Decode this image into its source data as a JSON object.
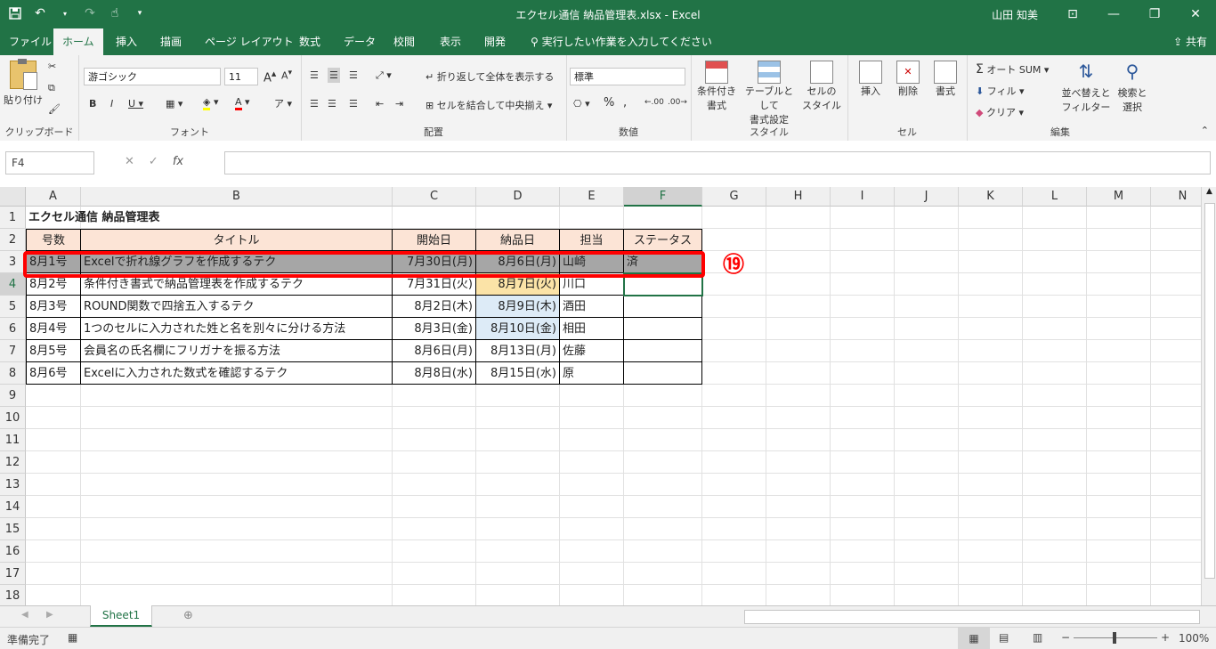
{
  "window": {
    "title": "エクセル通信 納品管理表.xlsx  -  Excel",
    "user": "山田 知美",
    "accent": "#217346"
  },
  "ribbon_tabs": [
    "ファイル",
    "ホーム",
    "挿入",
    "描画",
    "ページ レイアウト",
    "数式",
    "データ",
    "校閲",
    "表示",
    "開発"
  ],
  "tell_me": "実行したい作業を入力してください",
  "share_label": "共有",
  "ribbon": {
    "clipboard_group": "クリップボード",
    "paste_label": "貼り付け",
    "font_group": "フォント",
    "font_name": "游ゴシック",
    "font_size": "11",
    "alignment_group": "配置",
    "wrap_text": "折り返して全体を表示する",
    "merge_center": "セルを結合して中央揃え",
    "number_group": "数値",
    "number_format": "標準",
    "styles_group": "スタイル",
    "conditional_format": "条件付き",
    "conditional_format2": "書式",
    "format_as_table": "テーブルとして",
    "format_as_table2": "書式設定",
    "cell_styles": "セルの",
    "cell_styles2": "スタイル",
    "cells_group": "セル",
    "insert": "挿入",
    "delete": "削除",
    "format": "書式",
    "editing_group": "編集",
    "autosum": "オート SUM",
    "fill": "フィル",
    "clear": "クリア",
    "sort_filter": "並べ替えと",
    "sort_filter2": "フィルター",
    "find_select": "検索と",
    "find_select2": "選択"
  },
  "formula_bar": {
    "name_box": "F4",
    "value": ""
  },
  "columns": [
    "A",
    "B",
    "C",
    "D",
    "E",
    "F",
    "G",
    "H",
    "I",
    "J",
    "K",
    "L",
    "M",
    "N"
  ],
  "rows": [
    "1",
    "2",
    "3",
    "4",
    "5",
    "6",
    "7",
    "8",
    "9",
    "10",
    "11",
    "12",
    "13",
    "14",
    "15",
    "16",
    "17",
    "18"
  ],
  "sheet_title": "エクセル通信 納品管理表",
  "table_headers": [
    "号数",
    "タイトル",
    "開始日",
    "納品日",
    "担当",
    "ステータス"
  ],
  "table_rows": [
    [
      "8月1号",
      "Excelで折れ線グラフを作成するテク",
      "7月30日(月)",
      "8月6日(月)",
      "山崎",
      "済"
    ],
    [
      "8月2号",
      "条件付き書式で納品管理表を作成するテク",
      "7月31日(火)",
      "8月7日(火)",
      "川口",
      ""
    ],
    [
      "8月3号",
      "ROUND関数で四捨五入するテク",
      "8月2日(木)",
      "8月9日(木)",
      "酒田",
      ""
    ],
    [
      "8月4号",
      "1つのセルに入力された姓と名を別々に分ける方法",
      "8月3日(金)",
      "8月10日(金)",
      "相田",
      ""
    ],
    [
      "8月5号",
      "会員名の氏名欄にフリガナを振る方法",
      "8月6日(月)",
      "8月13日(月)",
      "佐藤",
      ""
    ],
    [
      "8月6号",
      "Excelに入力された数式を確認するテク",
      "8月8日(水)",
      "8月15日(水)",
      "原",
      ""
    ]
  ],
  "annotation": {
    "step": "⑲",
    "color": "#ff0000"
  },
  "sheet_tab": "Sheet1",
  "status": {
    "ready": "準備完了",
    "zoom": "100%"
  }
}
